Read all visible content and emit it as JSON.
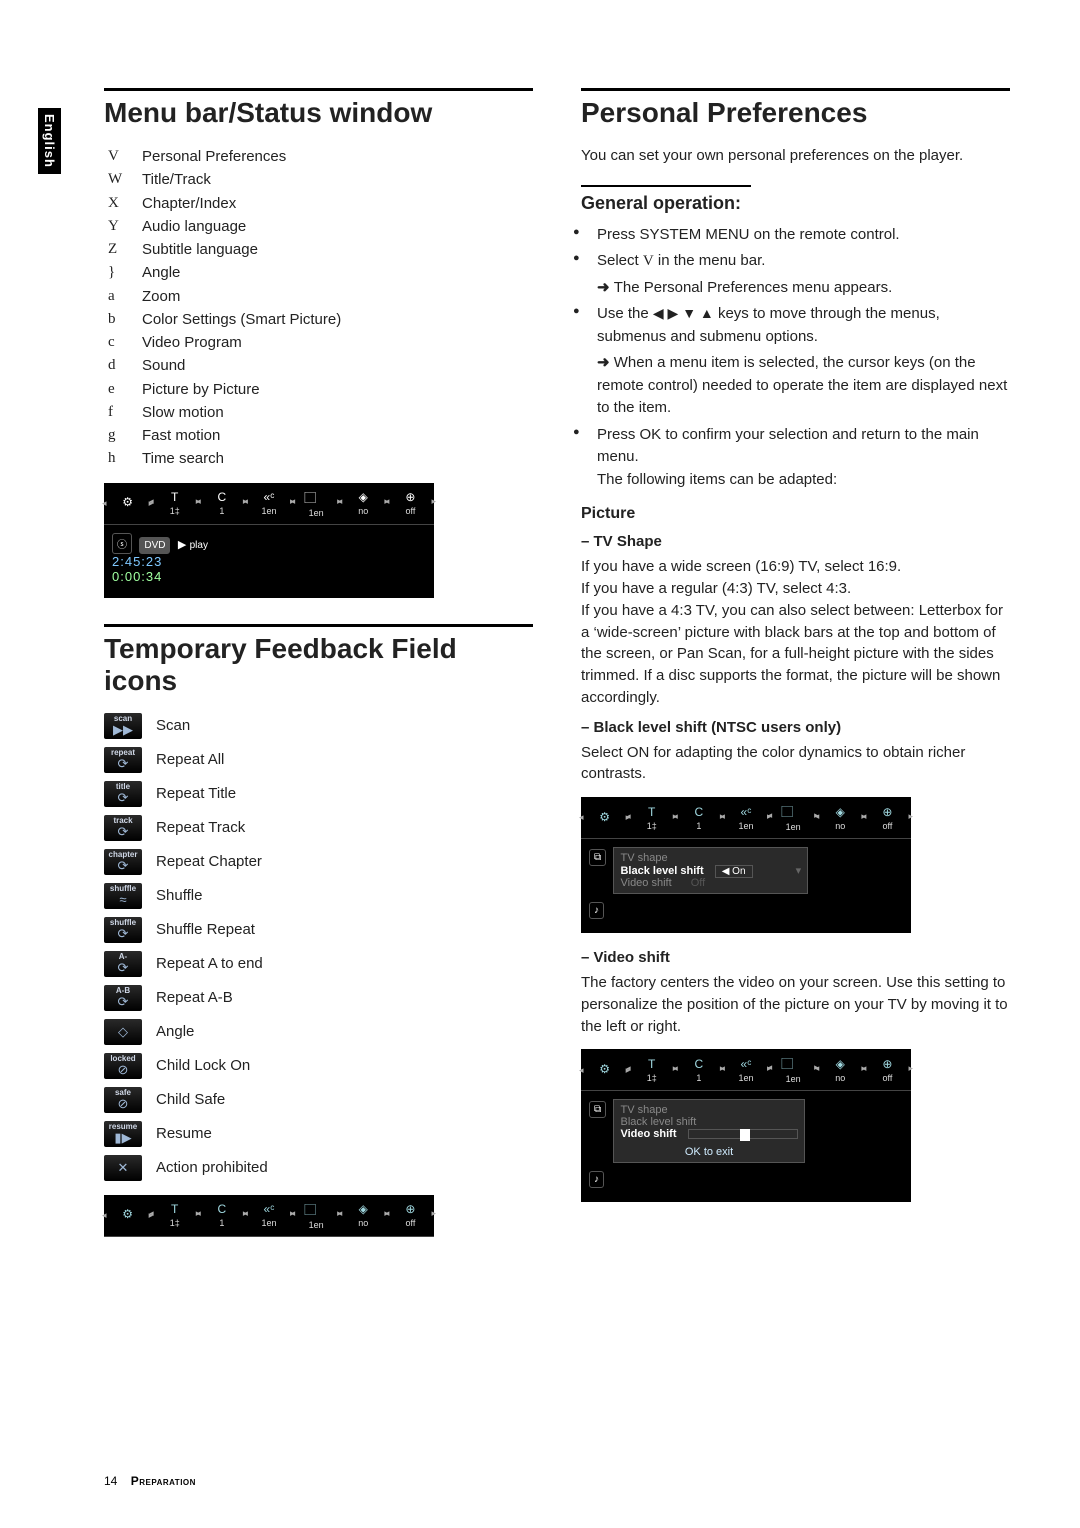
{
  "sidetab": "English",
  "left": {
    "h1": "Menu bar/Status window",
    "menubar": [
      {
        "k": "V",
        "t": "Personal Preferences"
      },
      {
        "k": "W",
        "t": "Title/Track"
      },
      {
        "k": "X",
        "t": "Chapter/Index"
      },
      {
        "k": "Y",
        "t": "Audio language"
      },
      {
        "k": "Z",
        "t": "Subtitle language"
      },
      {
        "k": "}",
        "t": "Angle"
      },
      {
        "k": "a",
        "t": "Zoom"
      },
      {
        "k": "b",
        "t": "Color Settings (Smart Picture)"
      },
      {
        "k": "c",
        "t": "Video Program"
      },
      {
        "k": "d",
        "t": "Sound"
      },
      {
        "k": "e",
        "t": "Picture by Picture"
      },
      {
        "k": "f",
        "t": "Slow motion"
      },
      {
        "k": "g",
        "t": "Fast motion"
      },
      {
        "k": "h",
        "t": "Time search"
      }
    ],
    "status_cells": [
      {
        "icon": "⚙",
        "val": ""
      },
      {
        "icon": "T",
        "val": "1‡"
      },
      {
        "icon": "C",
        "val": "1"
      },
      {
        "icon": "«ᶜ",
        "val": "1en"
      },
      {
        "icon": "⃞",
        "val": "1en"
      },
      {
        "icon": "◈",
        "val": "no"
      },
      {
        "icon": "⊕",
        "val": "off"
      }
    ],
    "status_body": {
      "badge1": "ⓢ",
      "badge2": "DVD",
      "play": "play",
      "time1": "2:45:23",
      "time2": "0:00:34",
      "tri": "▶"
    },
    "h2": "Temporary Feedback Field icons",
    "icons": [
      {
        "top": "scan",
        "glyph": "▶▶",
        "label": "Scan"
      },
      {
        "top": "repeat",
        "glyph": "⟳",
        "label": "Repeat All"
      },
      {
        "top": "title",
        "glyph": "⟳",
        "label": "Repeat Title"
      },
      {
        "top": "track",
        "glyph": "⟳",
        "label": "Repeat Track"
      },
      {
        "top": "chapter",
        "glyph": "⟳",
        "label": "Repeat Chapter"
      },
      {
        "top": "shuffle",
        "glyph": "≈",
        "label": "Shuffle"
      },
      {
        "top": "shuffle",
        "glyph": "⟳",
        "label": "Shuffle Repeat"
      },
      {
        "top": "A-",
        "glyph": "⟳",
        "label": "Repeat A to end"
      },
      {
        "top": "A-B",
        "glyph": "⟳",
        "label": "Repeat A-B"
      },
      {
        "top": "",
        "glyph": "◇",
        "label": "Angle"
      },
      {
        "top": "locked",
        "glyph": "⊘",
        "label": "Child Lock On"
      },
      {
        "top": "safe",
        "glyph": "⊘",
        "label": "Child Safe"
      },
      {
        "top": "resume",
        "glyph": "▮▶",
        "label": "Resume"
      },
      {
        "top": "",
        "glyph": "✕",
        "label": "Action prohibited"
      }
    ]
  },
  "right": {
    "h1": "Personal Preferences",
    "intro": "You can set your own personal preferences on the player.",
    "gen_h": "General operation:",
    "gen": {
      "b1": "Press SYSTEM MENU on the remote control.",
      "b2_pre": "Select ",
      "b2_sym": "V",
      "b2_post": " in the menu bar.",
      "b2_arrow": "The Personal Preferences menu appears.",
      "b3_pre": "Use the ",
      "b3_post": " keys to move through the menus, submenus and submenu options.",
      "b3_arrow": "When a menu item is selected, the cursor keys (on the remote control) needed to operate the item are displayed next to the item.",
      "b4": "Press OK to confirm your selection and return to the main menu.",
      "b4_after": "The following items can be adapted:"
    },
    "picture_h": "Picture",
    "tvshape_h": "–  TV Shape",
    "tvshape_body": "If you have a wide screen (16:9) TV, select 16:9.\nIf you have a regular (4:3) TV, select 4:3.\nIf you have a 4:3 TV, you can also select between: Letterbox for a ‘wide-screen’ picture with black bars at the top and bottom of the screen, or Pan Scan, for a full-height picture with the sides trimmed. If a disc supports the format, the picture will be shown accordingly.",
    "black_h": "–  Black level shift (NTSC users only)",
    "black_body": "Select ON for adapting the color dynamics to obtain richer contrasts.",
    "menu_black": {
      "i1": "TV shape",
      "i2": "Black level shift",
      "i3": "Video shift",
      "val": "On",
      "val2": "Off"
    },
    "vshift_h": "–  Video shift",
    "vshift_body": "The factory centers the video on your screen. Use this setting to personalize the position of the picture on your TV by moving it to the left or right.",
    "menu_vshift": {
      "i1": "TV shape",
      "i2": "Black level shift",
      "i3": "Video shift",
      "ok": "OK to exit"
    }
  },
  "footer": {
    "page": "14",
    "section": "Preparation"
  }
}
